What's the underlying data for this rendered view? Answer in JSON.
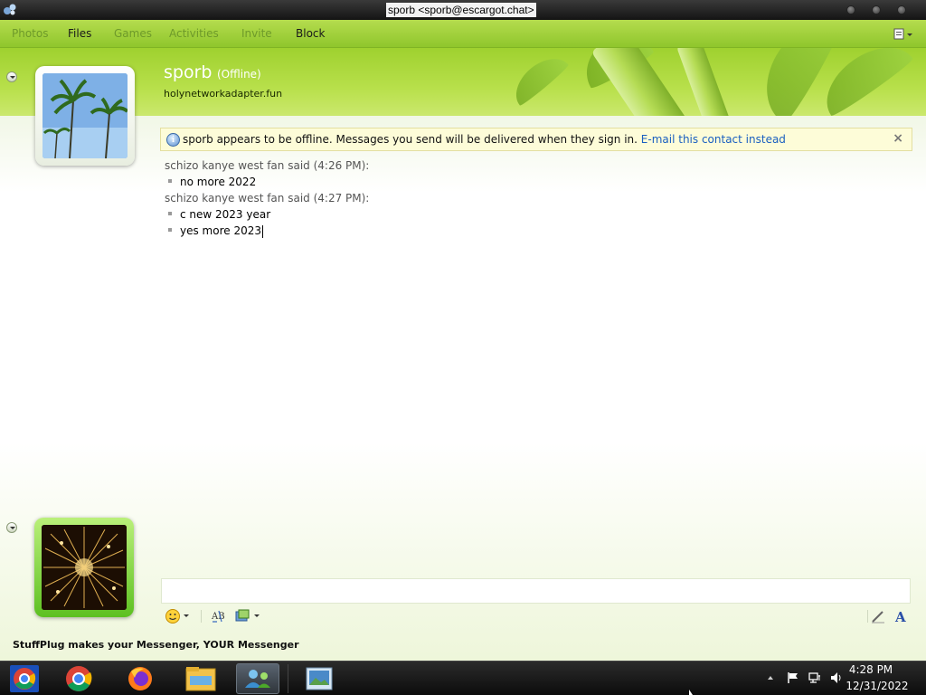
{
  "window": {
    "title": "sporb <sporb@escargot.chat>"
  },
  "menu": {
    "items": [
      {
        "label": "Photos",
        "enabled": false
      },
      {
        "label": "Files",
        "enabled": true
      },
      {
        "label": "Games",
        "enabled": false
      },
      {
        "label": "Activities",
        "enabled": false
      },
      {
        "label": "Invite",
        "enabled": false
      },
      {
        "label": "Block",
        "enabled": true
      }
    ]
  },
  "contact": {
    "name": "sporb",
    "status": "(Offline)",
    "personal_message": "holynetworkadapter.fun"
  },
  "infobar": {
    "message": "sporb appears to be offline. Messages you send will be delivered when they sign in.",
    "link": "E-mail this contact instead",
    "close": "×"
  },
  "conversation": [
    {
      "sender": "schizo kanye west fan said (4:26 PM):",
      "lines": [
        "no more 2022"
      ]
    },
    {
      "sender": "schizo kanye west fan said (4:27 PM):",
      "lines": [
        "c new 2023 year",
        "yes more 2023"
      ]
    }
  ],
  "input": {
    "value": ""
  },
  "footer": {
    "text": "StuffPlug makes your Messenger, YOUR Messenger"
  },
  "taskbar": {
    "time": "4:28 PM",
    "date": "12/31/2022"
  },
  "colors": {
    "theme_green": "#9fd12f",
    "link_blue": "#1a5fc0",
    "info_background": "#fdfcd8"
  },
  "icons": [
    "app-icon",
    "info-icon",
    "emoticon-icon",
    "spellcheck-icon",
    "send-image-icon",
    "handwriting-icon",
    "font-icon",
    "chrome-icon",
    "firefox-icon",
    "file-explorer-icon",
    "messenger-icon",
    "picture-icon",
    "flag-icon",
    "network-icon",
    "volume-icon"
  ]
}
